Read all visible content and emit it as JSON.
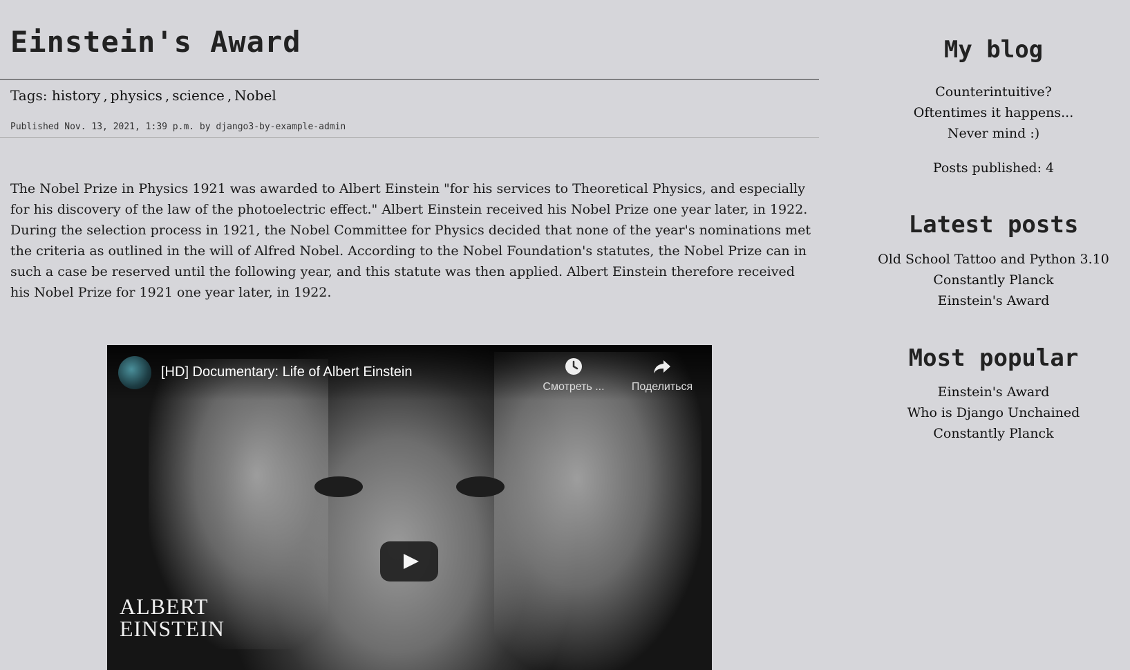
{
  "post": {
    "title": "Einstein's Award",
    "tags_label": "Tags:",
    "tags": [
      "history",
      "physics",
      "science",
      "Nobel"
    ],
    "tag_separator": ",",
    "published": "Published Nov. 13, 2021, 1:39 p.m. by django3-by-example-admin",
    "body": "The Nobel Prize in Physics 1921 was awarded to Albert Einstein \"for his services to Theoretical Physics, and especially for his discovery of the law of the photoelectric effect.\" Albert Einstein received his Nobel Prize one year later, in 1922. During the selection process in 1921, the Nobel Committee for Physics decided that none of the year's nominations met the criteria as outlined in the will of Alfred Nobel. According to the Nobel Foundation's statutes, the Nobel Prize can in such a case be reserved until the following year, and this statute was then applied. Albert Einstein therefore received his Nobel Prize for 1921 one year later, in 1922."
  },
  "video": {
    "title": "[HD] Documentary: Life of Albert Einstein",
    "watch_later_label": "Смотреть ...",
    "share_label": "Поделиться",
    "caption_line1": "ALBERT",
    "caption_line2": "EINSTEIN",
    "icons": {
      "watch_later": "clock-icon",
      "share": "share-arrow-icon",
      "play": "play-icon"
    }
  },
  "sidebar": {
    "title": "My blog",
    "tagline": [
      "Counterintuitive?",
      "Oftentimes it happens...",
      "Never mind :)"
    ],
    "posts_published": "Posts published: 4",
    "latest_title": "Latest posts",
    "latest": [
      "Old School Tattoo and Python 3.10",
      "Constantly Planck",
      "Einstein's Award"
    ],
    "popular_title": "Most popular",
    "popular": [
      "Einstein's Award",
      "Who is Django Unchained",
      "Constantly Planck"
    ]
  }
}
